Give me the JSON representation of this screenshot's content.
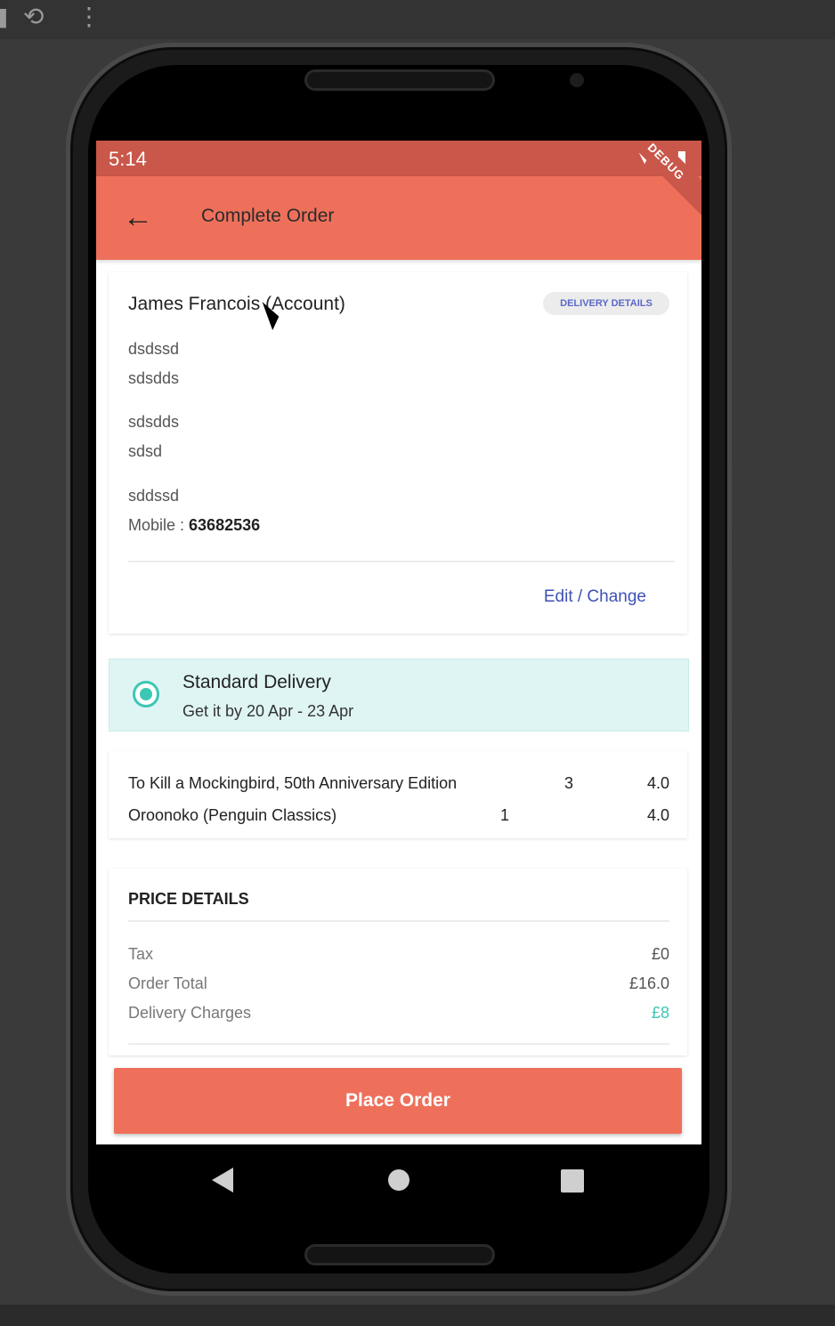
{
  "emulator": {
    "toolbar_icons": [
      "rotate-icon",
      "more-vert-icon"
    ]
  },
  "status_bar": {
    "time": "5:14",
    "icons": [
      "wifi-icon",
      "signal-icon",
      "battery-icon"
    ]
  },
  "app_bar": {
    "title": "Complete Order",
    "debug_banner": "DEBUG"
  },
  "address": {
    "name": "James Francois (Account)",
    "chip_label": "DELIVERY DETAILS",
    "lines": [
      "dsdssd",
      "sdsdds",
      "sdsdds",
      "sdsd",
      "sddssd"
    ],
    "mobile_label": "Mobile : ",
    "mobile_value": "63682536",
    "edit_label": "Edit / Change"
  },
  "delivery": {
    "title": "Standard Delivery",
    "subtitle": "Get it by 20 Apr - 23 Apr",
    "selected": true,
    "accent_color": "#3cc7b4"
  },
  "items": [
    {
      "name": "To Kill a Mockingbird, 50th Anniversary Edition",
      "qty": "3",
      "price": "4.0"
    },
    {
      "name": "Oroonoko (Penguin Classics)",
      "qty": "1",
      "price": "4.0"
    }
  ],
  "price_details": {
    "header": "PRICE DETAILS",
    "rows": [
      {
        "label": "Tax",
        "value": "£0"
      },
      {
        "label": "Order Total",
        "value": "£16.0"
      },
      {
        "label": "Delivery Charges",
        "value": "£8"
      }
    ]
  },
  "actions": {
    "place_order": "Place Order"
  },
  "colors": {
    "primary": "#ee705b",
    "status_bar": "#c9574a",
    "link": "#3f51b5",
    "teal": "#3cc7b4"
  }
}
